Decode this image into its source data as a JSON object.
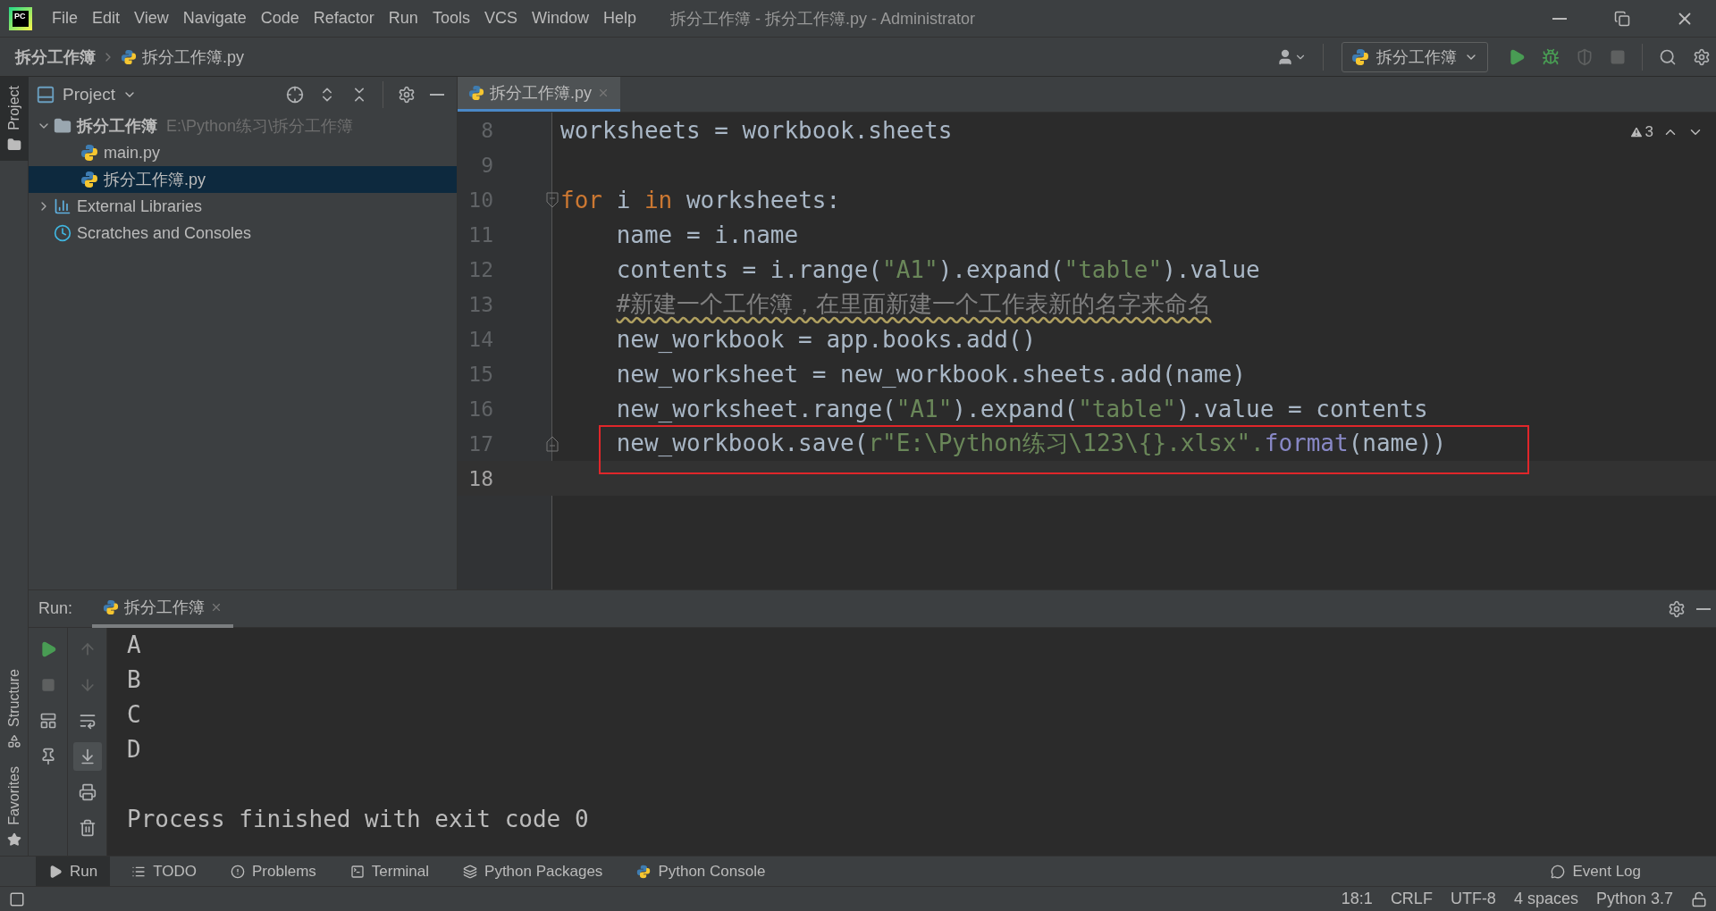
{
  "title_bar": {
    "logo": "PC",
    "menus": [
      "File",
      "Edit",
      "View",
      "Navigate",
      "Code",
      "Refactor",
      "Run",
      "Tools",
      "VCS",
      "Window",
      "Help"
    ],
    "title": "拆分工作簿 - 拆分工作簿.py - Administrator"
  },
  "nav_bar": {
    "breadcrumbs": [
      "拆分工作簿",
      "拆分工作簿.py"
    ],
    "run_config": "拆分工作簿"
  },
  "side_strip": {
    "top": [
      {
        "label": "Project",
        "selected": true
      }
    ],
    "bottom": [
      {
        "label": "Structure",
        "selected": false
      },
      {
        "label": "Favorites",
        "selected": false
      }
    ]
  },
  "project_panel": {
    "title": "Project",
    "tree": [
      {
        "label": "拆分工作簿",
        "path": "E:\\Python练习\\拆分工作簿",
        "kind": "project",
        "expanded": true,
        "selected": false,
        "children": [
          {
            "label": "main.py",
            "kind": "python",
            "selected": false
          },
          {
            "label": "拆分工作簿.py",
            "kind": "python",
            "selected": true
          }
        ]
      },
      {
        "label": "External Libraries",
        "kind": "libraries",
        "expanded": false,
        "selected": false
      },
      {
        "label": "Scratches and Consoles",
        "kind": "scratches",
        "selected": false
      }
    ]
  },
  "editor": {
    "tab": {
      "label": "拆分工作簿.py",
      "selected": true
    },
    "warnings": "3",
    "lines": [
      {
        "number": "8",
        "current": false,
        "tokens": [
          {
            "text": "worksheets = workbook.sheets",
            "kind": "plain"
          }
        ]
      },
      {
        "number": "9",
        "current": false
      },
      {
        "number": "10",
        "current": false,
        "fold": {
          "kind": "start"
        },
        "tokens": [
          {
            "text": "for",
            "kind": "keyword"
          },
          {
            "text": " i ",
            "kind": "plain"
          },
          {
            "text": "in",
            "kind": "keyword"
          },
          {
            "text": " worksheets:",
            "kind": "plain"
          }
        ]
      },
      {
        "number": "11",
        "current": false,
        "tokens": [
          {
            "text": "    name = i.name",
            "kind": "plain"
          }
        ]
      },
      {
        "number": "12",
        "current": false,
        "tokens": [
          {
            "text": "    contents = i.range(",
            "kind": "plain"
          },
          {
            "text": "\"A1\"",
            "kind": "string"
          },
          {
            "text": ").expand(",
            "kind": "plain"
          },
          {
            "text": "\"table\"",
            "kind": "string"
          },
          {
            "text": ").value",
            "kind": "plain"
          }
        ]
      },
      {
        "number": "13",
        "current": false,
        "tokens": [
          {
            "text": "    #新建一个工作簿，在里面新建一个工作表新的名字来命名",
            "kind": "comment",
            "typo": true
          }
        ]
      },
      {
        "number": "14",
        "current": false,
        "tokens": [
          {
            "text": "    new_workbook = app.books.add()",
            "kind": "plain"
          }
        ]
      },
      {
        "number": "15",
        "current": false,
        "tokens": [
          {
            "text": "    new_worksheet = new_workbook.sheets.add(name)",
            "kind": "plain"
          }
        ]
      },
      {
        "number": "16",
        "current": false,
        "tokens": [
          {
            "text": "    new_worksheet.range(",
            "kind": "plain"
          },
          {
            "text": "\"A1\"",
            "kind": "string"
          },
          {
            "text": ").expand(",
            "kind": "plain"
          },
          {
            "text": "\"table\"",
            "kind": "string"
          },
          {
            "text": ").value = contents",
            "kind": "plain"
          }
        ]
      },
      {
        "number": "17",
        "current": false,
        "fold": {
          "kind": "end"
        },
        "framed": true,
        "tokens": [
          {
            "text": "    new_workbook.save(",
            "kind": "plain"
          },
          {
            "text": "r\"E:\\Python练习\\123\\{}.xlsx\".",
            "kind": "string"
          },
          {
            "text": "format",
            "kind": "builtin"
          },
          {
            "text": "(name))",
            "kind": "plain"
          }
        ]
      },
      {
        "number": "18",
        "current": true
      }
    ]
  },
  "run_panel": {
    "label": "Run:",
    "tab": "拆分工作簿",
    "autoscroll": true,
    "output": [
      "A",
      "B",
      "C",
      "D"
    ],
    "exit_message": "Process finished with exit code 0"
  },
  "tool_tabs": [
    {
      "label": "Run",
      "kind": "run",
      "selected": true
    },
    {
      "label": "TODO",
      "kind": "todo",
      "selected": false
    },
    {
      "label": "Problems",
      "kind": "problems",
      "selected": false
    },
    {
      "label": "Terminal",
      "kind": "terminal",
      "selected": false
    },
    {
      "label": "Python Packages",
      "kind": "packages",
      "selected": false
    },
    {
      "label": "Python Console",
      "kind": "console",
      "selected": false
    }
  ],
  "event_log": "Event Log",
  "status_bar": {
    "items": [
      "18:1",
      "CRLF",
      "UTF-8",
      "4 spaces",
      "Python 3.7"
    ]
  }
}
